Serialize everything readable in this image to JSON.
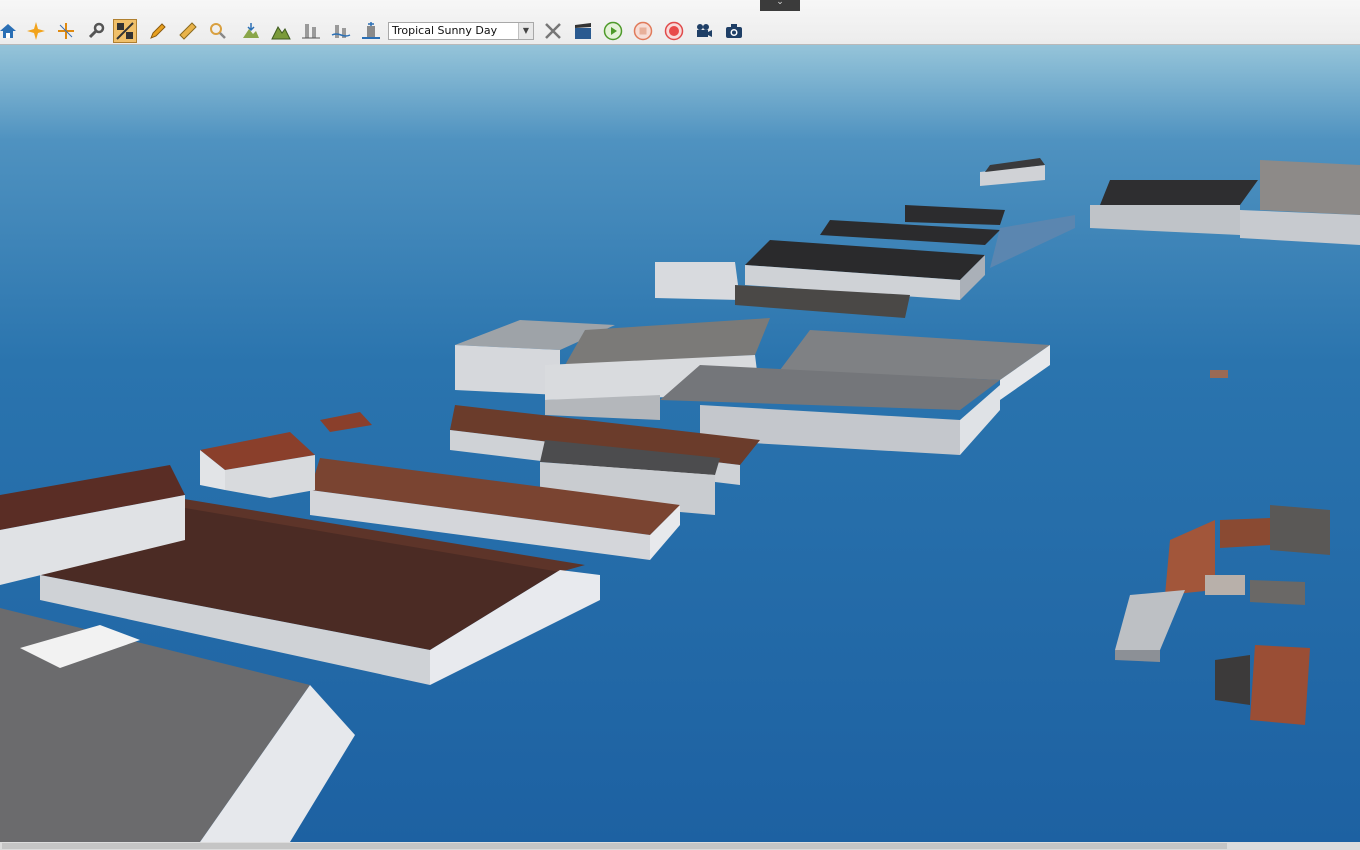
{
  "toolbar": {
    "environment": {
      "selected": "Tropical Sunny Day"
    },
    "buttons": [
      {
        "name": "home-button",
        "icon": "home-icon"
      },
      {
        "name": "select-button",
        "icon": "sparkle-icon"
      },
      {
        "name": "crosshair-button",
        "icon": "crosshair-icon"
      },
      {
        "name": "settings-button",
        "icon": "wrench-icon"
      },
      {
        "name": "measure-toggle-button",
        "icon": "measure-toggle-icon",
        "active": true
      },
      {
        "name": "draw-button",
        "icon": "pencil-icon"
      },
      {
        "name": "ruler-button",
        "icon": "ruler-icon"
      },
      {
        "name": "zoom-button",
        "icon": "magnifier-icon"
      },
      {
        "name": "terrain-tool-button",
        "icon": "terrain-icon"
      },
      {
        "name": "mountain-button",
        "icon": "mountain-icon"
      },
      {
        "name": "tree-button",
        "icon": "tree-icon"
      },
      {
        "name": "water-level-button",
        "icon": "water-level-icon"
      },
      {
        "name": "flood-tool-button",
        "icon": "flood-icon"
      },
      {
        "name": "clear-button",
        "icon": "cross-tools-icon"
      },
      {
        "name": "video-clip-button",
        "icon": "film-icon"
      },
      {
        "name": "play-button",
        "icon": "play-icon"
      },
      {
        "name": "stop-button",
        "icon": "stop-icon"
      },
      {
        "name": "record-button",
        "icon": "record-icon"
      },
      {
        "name": "camera-path-button",
        "icon": "video-camera-icon"
      },
      {
        "name": "screenshot-button",
        "icon": "camera-icon"
      }
    ]
  },
  "colors": {
    "water_top": "#8fbfd6",
    "water_mid": "#2f78b0",
    "water_deep": "#1e63a3",
    "roof_brown": "#6b3b2a",
    "roof_grey": "#8a8a8a",
    "wall": "#d6d8dc",
    "accent_active": "#f0c06a"
  }
}
